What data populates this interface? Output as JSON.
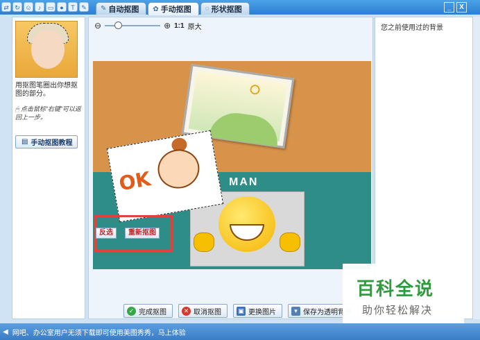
{
  "toolbar": {
    "icons": [
      "arrows-icon",
      "refresh-icon",
      "smiley-icon",
      "mic-icon",
      "keyboard-icon",
      "qq-icon",
      "shirt-icon",
      "wrench-icon"
    ]
  },
  "tabs": [
    {
      "label": "自动抠图",
      "active": false
    },
    {
      "label": "手动抠图",
      "active": true
    },
    {
      "label": "形状抠图",
      "active": false
    }
  ],
  "window": {
    "minimize": "_",
    "close": "X"
  },
  "left": {
    "hint": "用抠图笔圈出你想抠图的部分。",
    "tip": "点击鼠标“右键”可以返回上一步。",
    "tutorial_label": "手动抠图教程"
  },
  "zoom": {
    "ratio_label": "1:1",
    "original_label": "原大"
  },
  "canvas": {
    "man_text": "MAN",
    "ok_text": "OK",
    "invert_label": "反选",
    "redo_label": "重新抠图"
  },
  "actions": [
    {
      "label": "完成抠图",
      "icon": "check-icon",
      "color": "#35a845"
    },
    {
      "label": "取消抠图",
      "icon": "cancel-icon",
      "color": "#d9372b"
    },
    {
      "label": "更换图片",
      "icon": "image-icon",
      "color": "#3b74b8"
    },
    {
      "label": "保存为透明背景",
      "icon": "save-icon",
      "color": "#5580b4"
    }
  ],
  "right": {
    "title": "您之前使用过的背景"
  },
  "status": {
    "text": "网吧、办公室用户无须下载即可使用美图秀秀，马上体验"
  },
  "watermark": {
    "title": "百科全说",
    "subtitle": "助你轻松解决"
  }
}
